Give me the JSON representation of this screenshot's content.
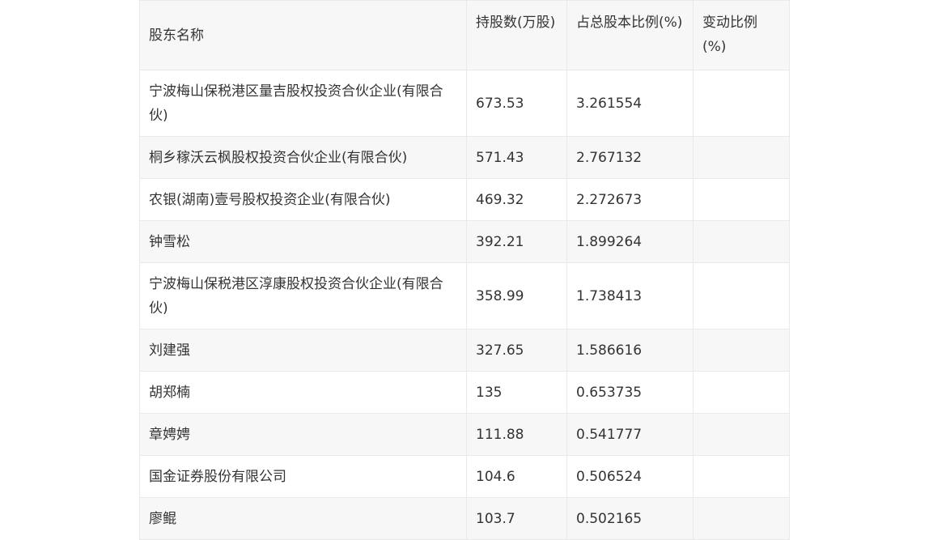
{
  "table": {
    "headers": [
      "股东名称",
      "持股数(万股)",
      "占总股本比例(%)",
      "变动比例(%)"
    ],
    "rows": [
      {
        "name": "宁波梅山保税港区量吉股权投资合伙企业(有限合伙)",
        "shares": "673.53",
        "ratio": "3.261554",
        "change": ""
      },
      {
        "name": "桐乡稼沃云枫股权投资合伙企业(有限合伙)",
        "shares": "571.43",
        "ratio": "2.767132",
        "change": ""
      },
      {
        "name": "农银(湖南)壹号股权投资企业(有限合伙)",
        "shares": "469.32",
        "ratio": "2.272673",
        "change": ""
      },
      {
        "name": "钟雪松",
        "shares": "392.21",
        "ratio": "1.899264",
        "change": ""
      },
      {
        "name": "宁波梅山保税港区淳康股权投资合伙企业(有限合伙)",
        "shares": "358.99",
        "ratio": "1.738413",
        "change": ""
      },
      {
        "name": "刘建强",
        "shares": "327.65",
        "ratio": "1.586616",
        "change": ""
      },
      {
        "name": "胡郑楠",
        "shares": "135",
        "ratio": "0.653735",
        "change": ""
      },
      {
        "name": "章娉娉",
        "shares": "111.88",
        "ratio": "0.541777",
        "change": ""
      },
      {
        "name": "国金证券股份有限公司",
        "shares": "104.6",
        "ratio": "0.506524",
        "change": ""
      },
      {
        "name": "廖鲲",
        "shares": "103.7",
        "ratio": "0.502165",
        "change": ""
      }
    ]
  }
}
